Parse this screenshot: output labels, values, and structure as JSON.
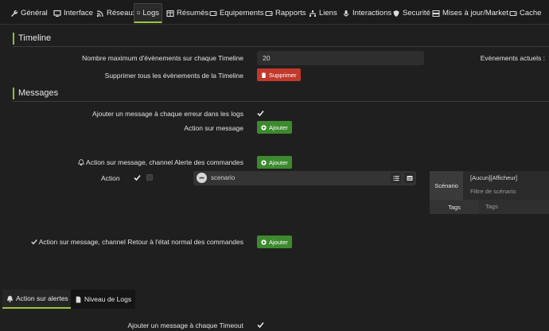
{
  "tabs": [
    {
      "label": "Général",
      "icon": "wrench-icon"
    },
    {
      "label": "Interface",
      "icon": "monitor-icon"
    },
    {
      "label": "Réseaux",
      "icon": "rss-icon"
    },
    {
      "label": "Logs",
      "icon": "file-icon"
    },
    {
      "label": "Résumés",
      "icon": "table-icon"
    },
    {
      "label": "Equipements",
      "icon": "hdd-icon"
    },
    {
      "label": "Rapports",
      "icon": "hdd-icon"
    },
    {
      "label": "Liens",
      "icon": "sitemap-icon"
    },
    {
      "label": "Interactions",
      "icon": "microphone-icon"
    },
    {
      "label": "Securité",
      "icon": "shield-icon"
    },
    {
      "label": "Mises à jour/Market",
      "icon": "server-icon"
    },
    {
      "label": "Cache",
      "icon": "hdd-icon"
    }
  ],
  "timeline": {
    "title": "Timeline",
    "max_events_label": "Nombre maximum d'évènements sur chaque Timeline",
    "max_events_value": "20",
    "current_events_label": "Evènements actuels :",
    "delete_all_label": "Supprimer tous les évènements de la Timeline",
    "delete_button": "Supprimer"
  },
  "messages": {
    "title": "Messages",
    "add_on_error_label": "Ajouter un message à chaque erreur dans les logs",
    "action_on_message_label": "Action sur message",
    "add_button": "Ajouter",
    "alert_channel_label": "Action sur message, channel Alerte des commandes",
    "action_label": "Action",
    "scenario_value": "scenario",
    "scenario_panel": {
      "label": "Scénario",
      "value": "[Aucun][Afficheur]",
      "filter_placeholder": "Filtre de scénario",
      "tags_label": "Tags",
      "tags_placeholder": "Tags"
    },
    "return_channel_label": "Action sur message, channel Retour à l'état normal des commandes"
  },
  "bottom_tabs": [
    {
      "label": "Action sur alertes",
      "icon": "bell-icon"
    },
    {
      "label": "Niveau de Logs",
      "icon": "file-icon"
    }
  ],
  "timeout_label": "Ajouter un message à chaque Timeout",
  "colors": {
    "accent": "#9bc53d",
    "danger": "#c0392b",
    "success": "#3d8a2e"
  }
}
